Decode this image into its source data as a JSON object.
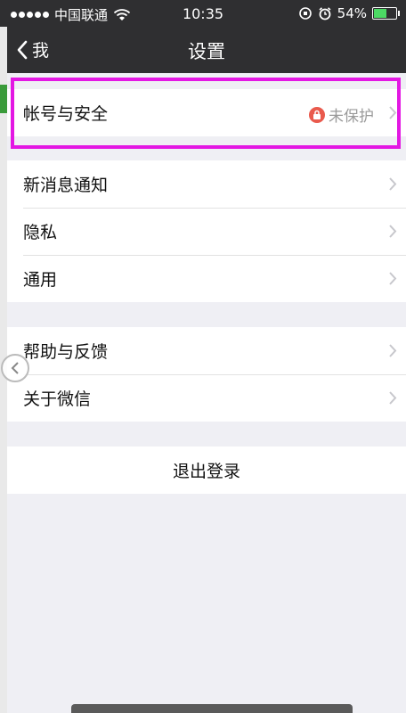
{
  "status_bar": {
    "carrier": "中国联通",
    "time": "10:35",
    "battery": "54%",
    "battery_level": 0.54
  },
  "nav": {
    "back_label": "我",
    "title": "设置"
  },
  "groups": [
    {
      "rows": [
        {
          "label": "帐号与安全",
          "status": "未保护"
        }
      ]
    },
    {
      "rows": [
        {
          "label": "新消息通知"
        },
        {
          "label": "隐私"
        },
        {
          "label": "通用"
        }
      ]
    },
    {
      "rows": [
        {
          "label": "帮助与反馈"
        },
        {
          "label": "关于微信"
        }
      ]
    }
  ],
  "logout_label": "退出登录",
  "colors": {
    "highlight": "#e317e3",
    "lock_badge": "#e95a4d",
    "battery": "#4cd964"
  }
}
